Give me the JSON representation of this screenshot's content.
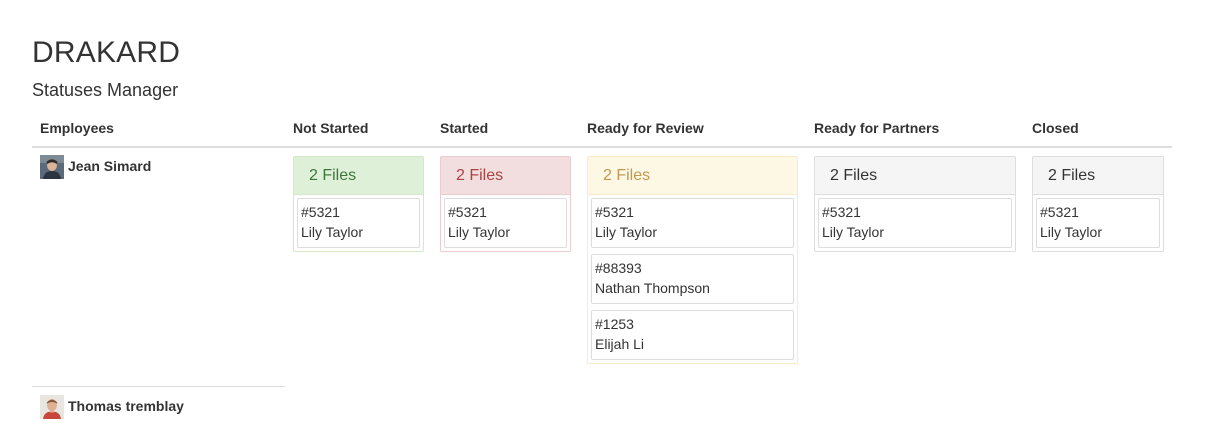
{
  "app": {
    "title": "DRAKARD",
    "subtitle": "Statuses Manager"
  },
  "columns": [
    "Employees",
    "Not Started",
    "Started",
    "Ready for Review",
    "Ready for Partners",
    "Closed"
  ],
  "employees": [
    {
      "name": "Jean Simard",
      "avatar_icon": "user-avatar-icon"
    },
    {
      "name": "Thomas tremblay",
      "avatar_icon": "user-avatar-icon"
    }
  ],
  "statuses": {
    "not_started": {
      "heading": "2 Files",
      "color": "#3c763d",
      "files": [
        {
          "id": "#5321",
          "client": "Lily Taylor"
        }
      ]
    },
    "started": {
      "heading": "2 Files",
      "color": "#a94442",
      "files": [
        {
          "id": "#5321",
          "client": "Lily Taylor"
        }
      ]
    },
    "ready_for_review": {
      "heading": "2 Files",
      "color": "#c09853",
      "files": [
        {
          "id": "#5321",
          "client": "Lily Taylor"
        },
        {
          "id": "#88393",
          "client": "Nathan Thompson"
        },
        {
          "id": "#1253",
          "client": "Elijah Li"
        }
      ]
    },
    "ready_for_partners": {
      "heading": "2 Files",
      "color": "#333333",
      "files": [
        {
          "id": "#5321",
          "client": "Lily Taylor"
        }
      ]
    },
    "closed": {
      "heading": "2 Files",
      "color": "#333333",
      "files": [
        {
          "id": "#5321",
          "client": "Lily Taylor"
        }
      ]
    }
  }
}
